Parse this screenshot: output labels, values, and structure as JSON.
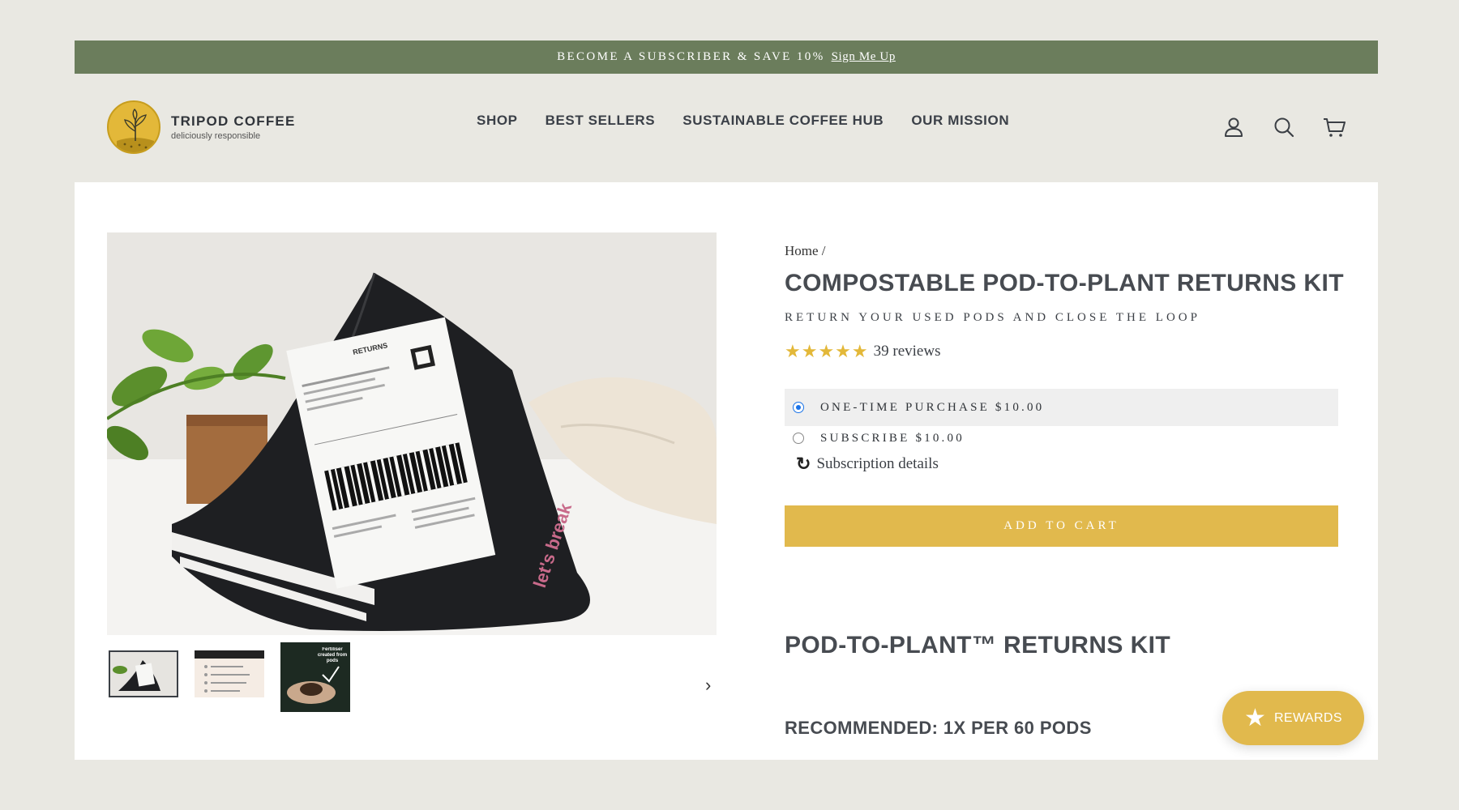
{
  "announcement": {
    "text": "BECOME A SUBSCRIBER & SAVE 10%",
    "link": "Sign Me Up"
  },
  "brand": {
    "name": "TRIPOD COFFEE",
    "tagline": "deliciously responsible",
    "accent": "#e3b839",
    "bar_color": "#6b7d5c"
  },
  "nav": {
    "items": [
      "SHOP",
      "BEST SELLERS",
      "SUSTAINABLE COFFEE HUB",
      "OUR MISSION"
    ]
  },
  "header_icons": [
    "account-icon",
    "search-icon",
    "cart-icon"
  ],
  "breadcrumb": {
    "home": "Home",
    "separator": "/"
  },
  "product": {
    "title": "COMPOSTABLE POD-TO-PLANT RETURNS KIT",
    "subtitle": "RETURN YOUR USED PODS AND CLOSE THE LOOP",
    "rating": 5,
    "reviews": "39 reviews",
    "options": [
      {
        "label": "ONE-TIME PURCHASE $10.00",
        "selected": true
      },
      {
        "label": "SUBSCRIBE $10.00",
        "selected": false
      }
    ],
    "subscription_details": "Subscription details",
    "add_to_cart": "ADD TO CART",
    "section_title": "POD-TO-PLANT™ RETURNS KIT",
    "recommended": "RECOMMENDED: 1X PER 60 PODS"
  },
  "gallery": {
    "label_text": "RETURNS",
    "bag_print": "let's break",
    "thumb3_text": "Fertiliser created from pods"
  },
  "rewards": {
    "label": "REWARDS"
  },
  "colors": {
    "button": "#e1b94d",
    "radio": "#1a73e8"
  }
}
